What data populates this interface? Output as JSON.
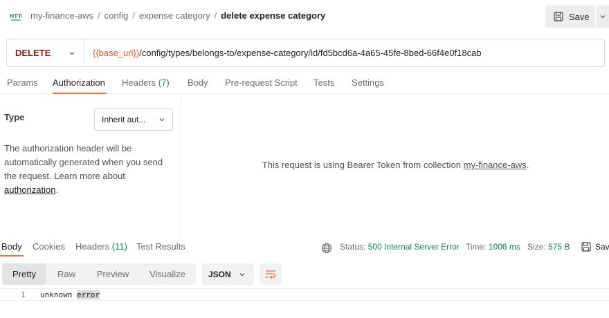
{
  "header": {
    "breadcrumbs": [
      "my-finance-aws",
      "config",
      "expense category"
    ],
    "current": "delete expense category",
    "save_label": "Save"
  },
  "request": {
    "method": "DELETE",
    "url_variable": "{{base_url}}",
    "url_path": "/config/types/belongs-to/expense-category/id/fd5bcd6a-4a65-45fe-8bed-66f4e0f18cab"
  },
  "request_tabs": [
    {
      "label": "Params"
    },
    {
      "label": "Authorization"
    },
    {
      "label": "Headers",
      "count": "(7)"
    },
    {
      "label": "Body"
    },
    {
      "label": "Pre-request Script"
    },
    {
      "label": "Tests"
    },
    {
      "label": "Settings"
    }
  ],
  "auth": {
    "type_label": "Type",
    "type_value": "Inherit aut...",
    "description": "The authorization header will be automatically generated when you send the request. Learn more about",
    "learn_link": "authorization",
    "info_text": "This request is using Bearer Token from collection",
    "collection_link": "my-finance-aws"
  },
  "response": {
    "tabs": [
      {
        "label": "Body"
      },
      {
        "label": "Cookies"
      },
      {
        "label": "Headers",
        "count": "(11)"
      },
      {
        "label": "Test Results"
      }
    ],
    "status_label": "Status:",
    "status_value": "500 Internal Server Error",
    "time_label": "Time:",
    "time_value": "1006 ms",
    "size_label": "Size:",
    "size_value": "575 B",
    "save_label": "Save"
  },
  "view": {
    "modes": [
      "Pretty",
      "Raw",
      "Preview",
      "Visualize"
    ],
    "format": "JSON"
  },
  "code": {
    "line_number": "1",
    "text_plain": "unknown ",
    "text_highlight": "error"
  },
  "colors": {
    "accent": "#ff6c37",
    "method": "#8e1a10",
    "variable": "#e05a2a",
    "status_ok_text": "#0b8a3c"
  }
}
